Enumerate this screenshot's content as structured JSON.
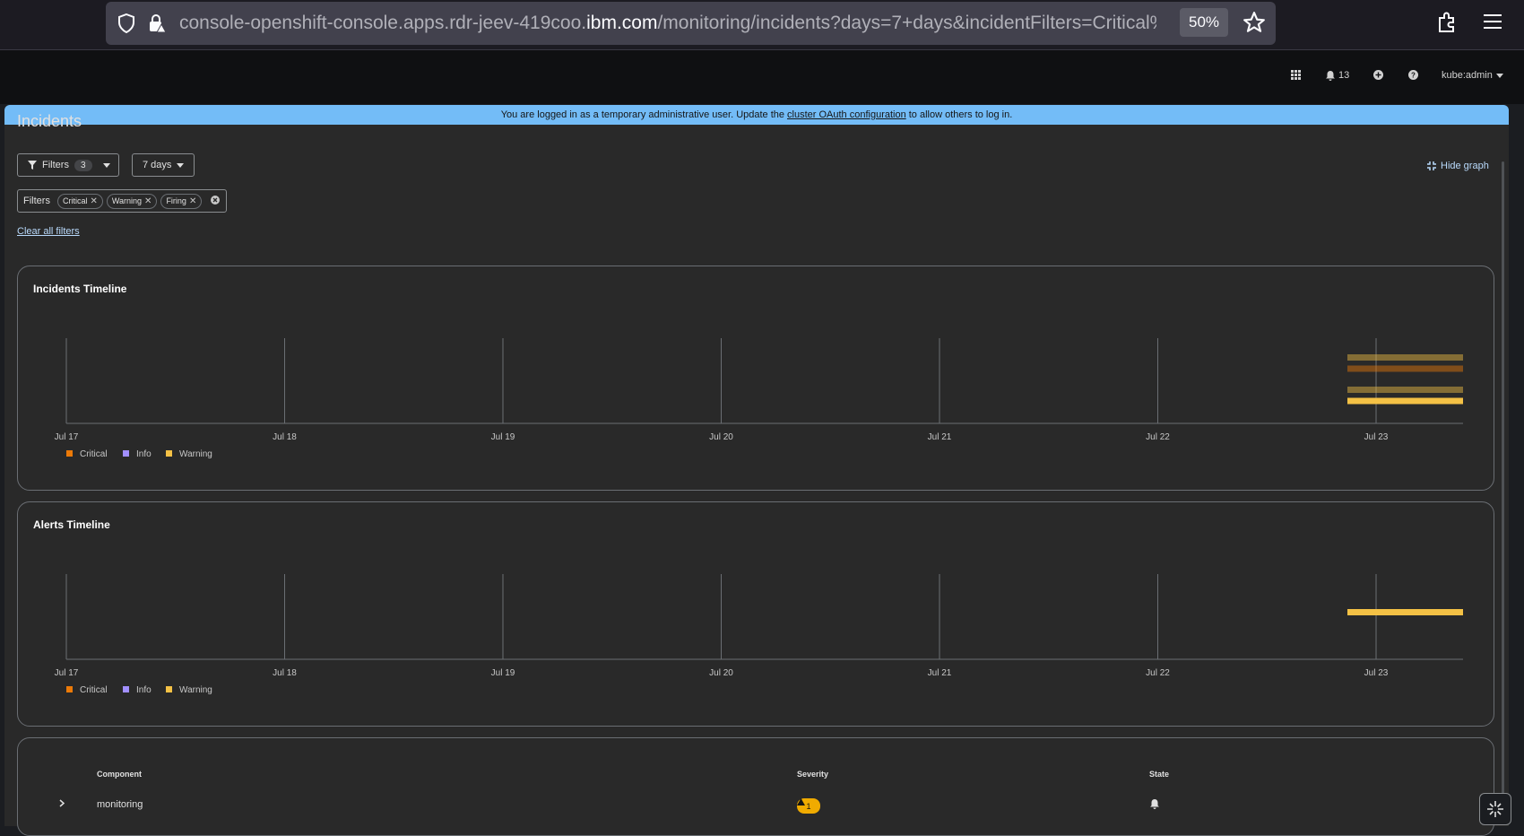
{
  "browser": {
    "url_prefix": "console-openshift-console.apps.rdr-jeev-419coo.",
    "url_domain": "ibm.com",
    "url_path": "/monitoring/incidents?days=7+days&incidentFilters=Critical%",
    "zoom": "50%"
  },
  "masthead": {
    "notifications_count": "13",
    "user": "kube:admin"
  },
  "banner": {
    "text_before": "You are logged in as a temporary administrative user. Update the",
    "link": "cluster OAuth configuration",
    "text_after": "to allow others to log in."
  },
  "page": {
    "title": "Incidents",
    "filters_label": "Filters",
    "filters_count": "3",
    "days_label": "7 days",
    "hide_graph": "Hide graph",
    "chip_group_label": "Filters",
    "chips": [
      "Critical",
      "Warning",
      "Firing"
    ],
    "clear_all": "Clear all filters"
  },
  "chart_data": [
    {
      "type": "bar",
      "title": "Incidents Timeline",
      "categories": [
        "Jul 17",
        "Jul 18",
        "Jul 19",
        "Jul 20",
        "Jul 21",
        "Jul 22",
        "Jul 23"
      ],
      "legend": [
        "Critical",
        "Info",
        "Warning"
      ],
      "colors": {
        "Critical": "#ec7a08",
        "Info": "#a18fff",
        "Warning": "#f4c145"
      },
      "series": [
        {
          "name": "Warning",
          "start": "Jul 23",
          "muted": true,
          "row": 1
        },
        {
          "name": "Critical",
          "start": "Jul 23",
          "muted": true,
          "row": 2
        },
        {
          "name": "Warning",
          "start": "Jul 23",
          "muted": true,
          "row": 3
        },
        {
          "name": "Warning",
          "start": "Jul 23",
          "muted": false,
          "row": 4
        }
      ],
      "grid": true
    },
    {
      "type": "bar",
      "title": "Alerts Timeline",
      "categories": [
        "Jul 17",
        "Jul 18",
        "Jul 19",
        "Jul 20",
        "Jul 21",
        "Jul 22",
        "Jul 23"
      ],
      "legend": [
        "Critical",
        "Info",
        "Warning"
      ],
      "colors": {
        "Critical": "#ec7a08",
        "Info": "#a18fff",
        "Warning": "#f4c145"
      },
      "series": [
        {
          "name": "Warning",
          "start": "Jul 23",
          "muted": false,
          "row": 1
        }
      ],
      "grid": true
    }
  ],
  "table": {
    "headers": [
      "Component",
      "Severity",
      "State"
    ],
    "rows": [
      {
        "component": "monitoring",
        "severity_count": "1"
      }
    ]
  }
}
